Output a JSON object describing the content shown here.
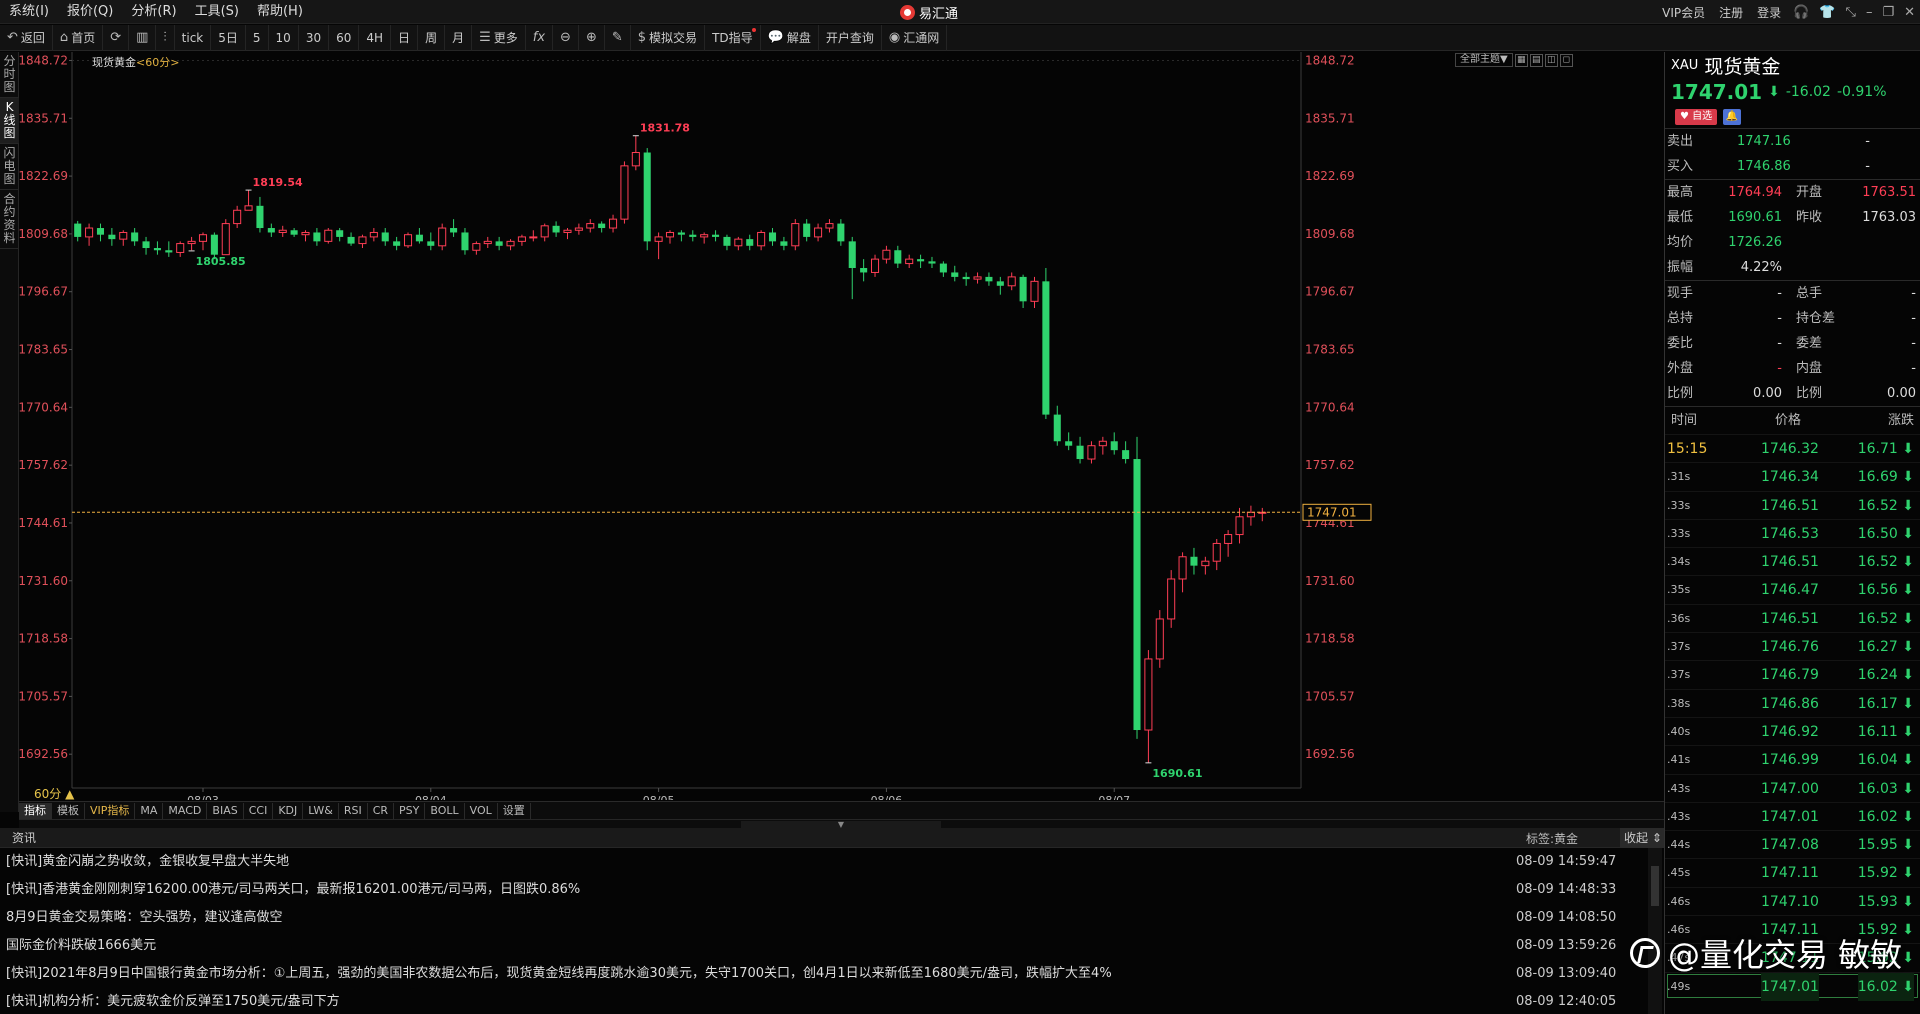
{
  "app": {
    "title": "易汇通"
  },
  "menu": [
    {
      "id": "system",
      "label": "系统(I)"
    },
    {
      "id": "quote",
      "label": "报价(Q)"
    },
    {
      "id": "analysis",
      "label": "分析(R)"
    },
    {
      "id": "tools",
      "label": "工具(S)"
    },
    {
      "id": "help",
      "label": "帮助(H)"
    }
  ],
  "right_menu": [
    {
      "id": "vip",
      "label": "VIP会员"
    },
    {
      "id": "register",
      "label": "注册"
    },
    {
      "id": "login",
      "label": "登录"
    }
  ],
  "toolbar": {
    "back": "返回",
    "home": "首页",
    "tick": "tick",
    "day5": "5日",
    "m5": "5",
    "m10": "10",
    "m30": "30",
    "m60": "60",
    "h4": "4H",
    "day": "日",
    "week": "周",
    "month": "月",
    "more": "更多",
    "fx": "fx",
    "sim_trade": "模拟交易",
    "td_guide": "TD指导",
    "jiepan": "解盘",
    "open_account": "开户查询",
    "huitong": "汇通网"
  },
  "left_tabs": [
    {
      "id": "timeshare",
      "label": "分时图"
    },
    {
      "id": "kline",
      "label": "K线图"
    },
    {
      "id": "flash",
      "label": "闪电图"
    },
    {
      "id": "contract",
      "label": "合约资料"
    }
  ],
  "chart": {
    "title": "现货黄金",
    "period_tag": "<60分>",
    "theme": "全部主题",
    "period_label": "60分 ▲"
  },
  "indicators": [
    {
      "id": "zb",
      "label": "指标"
    },
    {
      "id": "mb",
      "label": "模板"
    },
    {
      "id": "vip",
      "label": "VIP指标"
    },
    {
      "id": "ma",
      "label": "MA"
    },
    {
      "id": "macd",
      "label": "MACD"
    },
    {
      "id": "bias",
      "label": "BIAS"
    },
    {
      "id": "cci",
      "label": "CCI"
    },
    {
      "id": "kdj",
      "label": "KDJ"
    },
    {
      "id": "lwr",
      "label": "LW&"
    },
    {
      "id": "rsi",
      "label": "RSI"
    },
    {
      "id": "cr",
      "label": "CR"
    },
    {
      "id": "psy",
      "label": "PSY"
    },
    {
      "id": "boll",
      "label": "BOLL"
    },
    {
      "id": "vol",
      "label": "VOL"
    },
    {
      "id": "set",
      "label": "设置"
    }
  ],
  "news": {
    "header": "资讯",
    "tag_label": "标签:黄金",
    "fold_label": "收起",
    "items": [
      {
        "text": "[快讯]黄金闪崩之势收敛，金银收复早盘大半失地",
        "time": "08-09 14:59:47"
      },
      {
        "text": "[快讯]香港黄金刚刚刺穿16200.00港元/司马两关口，最新报16201.00港元/司马两，日图跌0.86%",
        "time": "08-09 14:48:33"
      },
      {
        "text": "8月9日黄金交易策略：空头强势，建议逢高做空",
        "time": "08-09 14:08:50"
      },
      {
        "text": "国际金价料跌破1666美元",
        "time": "08-09 13:59:26"
      },
      {
        "text": "[快讯]2021年8月9日中国银行黄金市场分析：①上周五，强劲的美国非农数据公布后，现货黄金短线再度跳水逾30美元，失守1700关口，创4月1日以来新低至1680美元/盎司，跌幅扩大至4%",
        "time": "08-09 13:09:40"
      },
      {
        "text": "[快讯]机构分析：美元疲软金价反弹至1750美元/盎司下方",
        "time": "08-09 12:40:05"
      }
    ]
  },
  "watermark": {
    "text": "@量化交易 敏敏"
  },
  "quote": {
    "code": "XAU",
    "name": "现货黄金",
    "price": "1747.01",
    "change": "-16.02",
    "change_pct": "-0.91%",
    "fav_label": "自选",
    "rows": [
      {
        "l": "卖出",
        "v": "1747.16",
        "l2": "",
        "v2": "-",
        "vc": "green"
      },
      {
        "l": "买入",
        "v": "1746.86",
        "l2": "",
        "v2": "-",
        "vc": "green"
      }
    ],
    "stats": [
      {
        "l": "最高",
        "v": "1764.94",
        "l2": "开盘",
        "v2": "1763.51",
        "vc": "red",
        "v2c": "red"
      },
      {
        "l": "最低",
        "v": "1690.61",
        "l2": "昨收",
        "v2": "1763.03",
        "vc": "green",
        "v2c": ""
      },
      {
        "l": "均价",
        "v": "1726.26",
        "l2": "",
        "v2": "",
        "vc": "green",
        "v2c": ""
      },
      {
        "l": "振幅",
        "v": "4.22%",
        "l2": "",
        "v2": "",
        "vc": "",
        "v2c": ""
      }
    ],
    "vol": [
      {
        "l": "现手",
        "v": "-",
        "l2": "总手",
        "v2": "-"
      },
      {
        "l": "总持",
        "v": "-",
        "l2": "持仓差",
        "v2": "-"
      },
      {
        "l": "委比",
        "v": "-",
        "l2": "委差",
        "v2": "-"
      },
      {
        "l": "外盘",
        "v": "-",
        "l2": "内盘",
        "v2": "-",
        "vc": "red"
      },
      {
        "l": "比例",
        "v": "0.00",
        "l2": "比例",
        "v2": "0.00"
      }
    ],
    "tick_header": {
      "time": "时间",
      "price": "价格",
      "chg": "涨跌"
    },
    "ticks": [
      {
        "t": "15:15",
        "p": "1746.32",
        "c": "16.71"
      },
      {
        "t": ".31s",
        "p": "1746.34",
        "c": "16.69"
      },
      {
        "t": ".33s",
        "p": "1746.51",
        "c": "16.52"
      },
      {
        "t": ".33s",
        "p": "1746.53",
        "c": "16.50"
      },
      {
        "t": ".34s",
        "p": "1746.51",
        "c": "16.52"
      },
      {
        "t": ".35s",
        "p": "1746.47",
        "c": "16.56"
      },
      {
        "t": ".36s",
        "p": "1746.51",
        "c": "16.52"
      },
      {
        "t": ".37s",
        "p": "1746.76",
        "c": "16.27"
      },
      {
        "t": ".37s",
        "p": "1746.79",
        "c": "16.24"
      },
      {
        "t": ".38s",
        "p": "1746.86",
        "c": "16.17"
      },
      {
        "t": ".40s",
        "p": "1746.92",
        "c": "16.11"
      },
      {
        "t": ".41s",
        "p": "1746.99",
        "c": "16.04"
      },
      {
        "t": ".43s",
        "p": "1747.00",
        "c": "16.03"
      },
      {
        "t": ".43s",
        "p": "1747.01",
        "c": "16.02"
      },
      {
        "t": ".44s",
        "p": "1747.08",
        "c": "15.95"
      },
      {
        "t": ".45s",
        "p": "1747.11",
        "c": "15.92"
      },
      {
        "t": ".46s",
        "p": "1747.10",
        "c": "15.93"
      },
      {
        "t": ".46s",
        "p": "1747.11",
        "c": "15.92"
      },
      {
        "t": ".47s",
        "p": "1747.11",
        "c": "15.92"
      },
      {
        "t": ".49s",
        "p": "1747.01",
        "c": "16.02"
      }
    ]
  },
  "chart_data": {
    "type": "candlestick",
    "y_ticks": [
      1848.72,
      1835.71,
      1822.69,
      1809.68,
      1796.67,
      1783.65,
      1770.64,
      1757.62,
      1744.61,
      1731.6,
      1718.58,
      1705.57,
      1692.56
    ],
    "ylim": [
      1689.0,
      1849.5
    ],
    "x_ticks": [
      {
        "label": "08/03",
        "at": 11
      },
      {
        "label": "08/04",
        "at": 31
      },
      {
        "label": "08/05",
        "at": 51
      },
      {
        "label": "08/06",
        "at": 71
      },
      {
        "label": "08/07",
        "at": 91
      }
    ],
    "last_price": 1747.01,
    "annotations": [
      {
        "label": "1819.54",
        "value": 1819.54
      },
      {
        "label": "1805.85",
        "value": 1805.85
      },
      {
        "label": "1831.78",
        "value": 1831.78
      },
      {
        "label": "1690.61",
        "value": 1690.61
      }
    ],
    "candles": [
      [
        1812,
        1812.6,
        1808,
        1809
      ],
      [
        1809,
        1812,
        1807,
        1811
      ],
      [
        1811,
        1812,
        1808,
        1809.5
      ],
      [
        1809.5,
        1811,
        1807,
        1808.5
      ],
      [
        1808.5,
        1810.5,
        1807,
        1810
      ],
      [
        1810,
        1811,
        1807,
        1808
      ],
      [
        1808,
        1809,
        1805,
        1806.5
      ],
      [
        1806.5,
        1808,
        1805,
        1806
      ],
      [
        1806,
        1808,
        1804.5,
        1805.5
      ],
      [
        1805.5,
        1808,
        1804.5,
        1807.5
      ],
      [
        1807.5,
        1809,
        1806,
        1808
      ],
      [
        1808,
        1810,
        1806,
        1809.5
      ],
      [
        1809.5,
        1810,
        1804,
        1805
      ],
      [
        1805,
        1813,
        1805,
        1812
      ],
      [
        1812,
        1816,
        1811,
        1815
      ],
      [
        1815,
        1819.54,
        1815,
        1816
      ],
      [
        1816,
        1818,
        1810,
        1811
      ],
      [
        1811,
        1812,
        1809,
        1810
      ],
      [
        1810,
        1811.5,
        1809,
        1810.5
      ],
      [
        1810.5,
        1811,
        1809,
        1809.5
      ],
      [
        1809.5,
        1810.5,
        1808,
        1810
      ],
      [
        1810,
        1811,
        1807,
        1808
      ],
      [
        1808,
        1811,
        1807.5,
        1810.5
      ],
      [
        1810.5,
        1811,
        1808,
        1809
      ],
      [
        1809,
        1810,
        1807,
        1807.5
      ],
      [
        1807.5,
        1809.5,
        1806.5,
        1809
      ],
      [
        1809,
        1811,
        1808,
        1810
      ],
      [
        1810,
        1811,
        1807,
        1808
      ],
      [
        1808,
        1809,
        1806,
        1807
      ],
      [
        1807,
        1810,
        1806.5,
        1809.5
      ],
      [
        1809.5,
        1811,
        1807.5,
        1808
      ],
      [
        1808,
        1810,
        1806,
        1807
      ],
      [
        1807,
        1812,
        1806,
        1811
      ],
      [
        1811,
        1813,
        1809,
        1810
      ],
      [
        1810,
        1811,
        1805,
        1806
      ],
      [
        1806,
        1808,
        1805,
        1807.5
      ],
      [
        1807.5,
        1809,
        1806.5,
        1808
      ],
      [
        1808,
        1809,
        1806,
        1807
      ],
      [
        1807,
        1808.5,
        1806,
        1808
      ],
      [
        1808,
        1809.5,
        1807,
        1809
      ],
      [
        1809,
        1810.5,
        1808,
        1809
      ],
      [
        1809,
        1812,
        1808,
        1811.5
      ],
      [
        1811.5,
        1812.5,
        1809,
        1810
      ],
      [
        1810,
        1811,
        1808.5,
        1810.5
      ],
      [
        1810.5,
        1812,
        1809.5,
        1811
      ],
      [
        1811,
        1813,
        1810,
        1812
      ],
      [
        1812,
        1812.5,
        1810,
        1811
      ],
      [
        1811,
        1814,
        1810,
        1813
      ],
      [
        1813,
        1826,
        1812,
        1825
      ],
      [
        1825,
        1831.78,
        1824,
        1828
      ],
      [
        1828,
        1829,
        1806,
        1808
      ],
      [
        1808,
        1810,
        1804,
        1809
      ],
      [
        1809,
        1810.5,
        1807.5,
        1810
      ],
      [
        1810,
        1810.5,
        1808,
        1809.5
      ],
      [
        1809.5,
        1810.5,
        1808,
        1809
      ],
      [
        1809,
        1810,
        1807.5,
        1809.5
      ],
      [
        1809.5,
        1810.5,
        1808,
        1809
      ],
      [
        1809,
        1809.5,
        1806,
        1807
      ],
      [
        1807,
        1809,
        1806,
        1808.5
      ],
      [
        1808.5,
        1809.5,
        1806,
        1807
      ],
      [
        1807,
        1810.5,
        1806,
        1810
      ],
      [
        1810,
        1811,
        1807,
        1808
      ],
      [
        1808,
        1809,
        1806,
        1807
      ],
      [
        1807,
        1813,
        1806,
        1812
      ],
      [
        1812,
        1813,
        1808,
        1809
      ],
      [
        1809,
        1812,
        1808,
        1811
      ],
      [
        1811,
        1813,
        1810,
        1812
      ],
      [
        1812,
        1813,
        1807,
        1808
      ],
      [
        1808,
        1809,
        1795,
        1802
      ],
      [
        1802,
        1804,
        1799,
        1801
      ],
      [
        1801,
        1805,
        1800,
        1804
      ],
      [
        1804,
        1807,
        1803,
        1806
      ],
      [
        1806,
        1807,
        1802,
        1803
      ],
      [
        1803,
        1805,
        1802,
        1804
      ],
      [
        1804,
        1805,
        1802,
        1803.5
      ],
      [
        1803.5,
        1804.5,
        1802,
        1803
      ],
      [
        1803,
        1803.5,
        1800,
        1801
      ],
      [
        1801,
        1802.5,
        1799,
        1800
      ],
      [
        1800,
        1801,
        1798,
        1799.5
      ],
      [
        1799.5,
        1801,
        1798.5,
        1800
      ],
      [
        1800,
        1801,
        1798,
        1799
      ],
      [
        1799,
        1800,
        1796,
        1798
      ],
      [
        1798,
        1801,
        1797,
        1800
      ],
      [
        1800,
        1800.5,
        1793,
        1794.5
      ],
      [
        1794.5,
        1800,
        1793,
        1799
      ],
      [
        1799,
        1802,
        1768,
        1769
      ],
      [
        1769,
        1771,
        1762,
        1763
      ],
      [
        1763,
        1765,
        1761,
        1762
      ],
      [
        1762,
        1764,
        1758,
        1759
      ],
      [
        1759,
        1763,
        1758,
        1762
      ],
      [
        1762,
        1764,
        1760,
        1763
      ],
      [
        1763,
        1765,
        1760,
        1761
      ],
      [
        1761,
        1763,
        1758,
        1759
      ],
      [
        1759,
        1764,
        1696,
        1698
      ],
      [
        1698,
        1716,
        1690.61,
        1714
      ],
      [
        1714,
        1725,
        1712,
        1723
      ],
      [
        1723,
        1734,
        1721,
        1732
      ],
      [
        1732,
        1738,
        1729,
        1737
      ],
      [
        1737,
        1739,
        1733,
        1735
      ],
      [
        1735,
        1737,
        1733,
        1736
      ],
      [
        1736,
        1741,
        1734,
        1740
      ],
      [
        1740,
        1743,
        1737,
        1742
      ],
      [
        1742,
        1748,
        1740,
        1746
      ],
      [
        1746,
        1748.5,
        1744,
        1747
      ],
      [
        1747,
        1748,
        1745,
        1747.01
      ]
    ]
  }
}
